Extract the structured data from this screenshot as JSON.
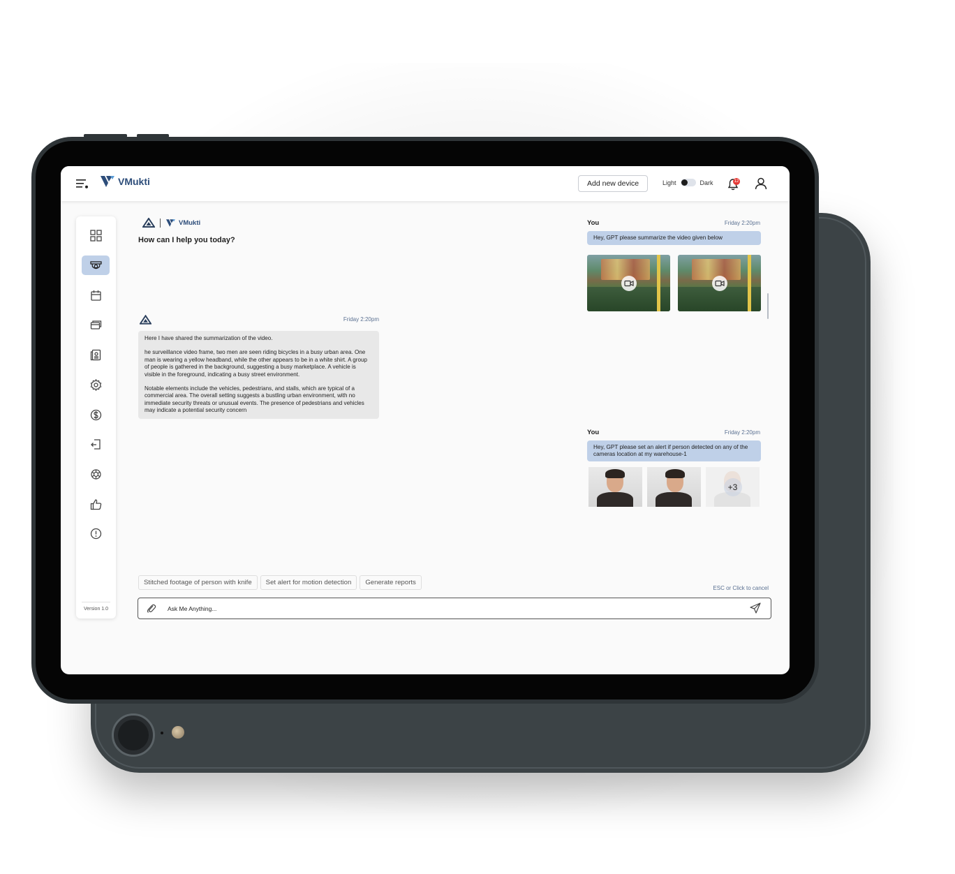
{
  "brand": {
    "name": "VMukti"
  },
  "topbar": {
    "add_device_label": "Add new device",
    "theme_light": "Light",
    "theme_dark": "Dark",
    "notification_count": "12"
  },
  "sidebar": {
    "items": [
      {
        "icon": "dashboard-grid-icon",
        "active": false
      },
      {
        "icon": "cctv-camera-icon",
        "active": true
      },
      {
        "icon": "calendar-icon",
        "active": false
      },
      {
        "icon": "gallery-icon",
        "active": false
      },
      {
        "icon": "report-document-icon",
        "active": false
      },
      {
        "icon": "gear-icon",
        "active": false
      },
      {
        "icon": "dollar-icon",
        "active": false
      },
      {
        "icon": "export-icon",
        "active": false
      },
      {
        "icon": "openai-icon",
        "active": false
      },
      {
        "icon": "thumbs-up-icon",
        "active": false
      },
      {
        "icon": "alert-circle-icon",
        "active": false
      }
    ],
    "version": "Version 1.0"
  },
  "chat": {
    "greeting": "How can I help you today?",
    "bot_time": "Friday 2:20pm",
    "bot_message": [
      "Here I have shared the summarization of the video.",
      "he surveillance video frame, two men are seen riding bicycles in a busy urban area. One man is wearing a yellow headband, while the other appears to be in a white shirt. A group of people is gathered in the background, suggesting a busy marketplace. A vehicle is visible in the foreground, indicating a busy street environment.",
      "Notable elements include the vehicles, pedestrians, and stalls, which are typical of a commercial area. The overall setting suggests a bustling urban environment, with no immediate security threats or unusual events. The presence of pedestrians and vehicles may indicate a potential security concern"
    ],
    "user_messages": [
      {
        "label": "You",
        "time": "Friday 2:20pm",
        "text": "Hey, GPT please summarize the video given below"
      },
      {
        "label": "You",
        "time": "Friday 2:20pm",
        "text": "Hey, GPT please set an alert if person detected on any of the cameras location at my warehouse-1"
      }
    ],
    "more_faces": "+3"
  },
  "suggestions": [
    "Stitched footage of person with knife",
    "Set alert for motion detection",
    "Generate reports"
  ],
  "composer": {
    "cancel_hint": "ESC or Click to cancel",
    "placeholder": "Ask Me Anything..."
  }
}
